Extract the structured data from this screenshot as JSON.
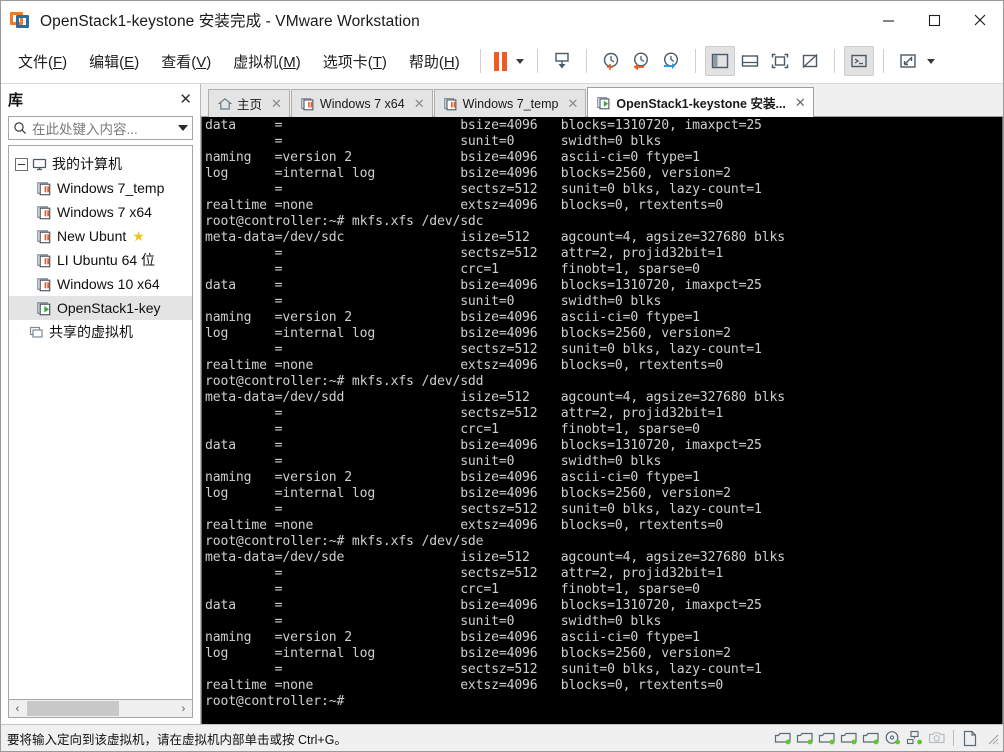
{
  "window": {
    "title": "OpenStack1-keystone 安装完成 - VMware Workstation",
    "logo_icon": "vmware-logo-icon",
    "minimize_label": "最小化",
    "maximize_label": "最大化",
    "close_label": "关闭"
  },
  "menubar": {
    "items": [
      {
        "label": "文件(F)",
        "text": "文件(",
        "accel": "F",
        "tail": ")"
      },
      {
        "label": "编辑(E)",
        "text": "编辑(",
        "accel": "E",
        "tail": ")"
      },
      {
        "label": "查看(V)",
        "text": "查看(",
        "accel": "V",
        "tail": ")"
      },
      {
        "label": "虚拟机(M)",
        "text": "虚拟机(",
        "accel": "M",
        "tail": ")"
      },
      {
        "label": "选项卡(T)",
        "text": "选项卡(",
        "accel": "T",
        "tail": ")"
      },
      {
        "label": "帮助(H)",
        "text": "帮助(",
        "accel": "H",
        "tail": ")"
      }
    ]
  },
  "toolbar": {
    "buttons": [
      {
        "name": "suspend-button",
        "icon": "pause-icon",
        "title": "挂起此虚拟机"
      },
      {
        "name": "power-dropdown",
        "icon": "chevron-down-icon",
        "title": "电源选项"
      },
      {
        "name": "snapshot-button",
        "icon": "snapshot-icon",
        "title": "拍摄此虚拟机的快照"
      },
      {
        "name": "take-snapshot-button",
        "icon": "take-snapshot-icon",
        "title": "拍摄快照"
      },
      {
        "name": "revert-snapshot-button",
        "icon": "revert-snapshot-icon",
        "title": "恢复到快照"
      },
      {
        "name": "snapshot-manager-button",
        "icon": "snapshot-manager-icon",
        "title": "管理快照"
      },
      {
        "name": "show-library-button",
        "icon": "sidebar-panel-icon",
        "title": "显示或隐藏库",
        "active": true
      },
      {
        "name": "show-thumbnail-button",
        "icon": "thumbnail-bar-icon",
        "title": "显示或隐藏缩略图栏"
      },
      {
        "name": "fullscreen-button",
        "icon": "fullscreen-icon",
        "title": "进入全屏模式"
      },
      {
        "name": "unity-button",
        "icon": "unity-mode-icon",
        "title": "进入 Unity 模式"
      },
      {
        "name": "console-button",
        "icon": "terminal-icon",
        "title": "控制台视图",
        "active": true
      },
      {
        "name": "stretch-button",
        "icon": "stretch-icon",
        "title": "拉伸显示"
      },
      {
        "name": "stretch-dropdown",
        "icon": "chevron-down-icon",
        "title": "显示选项"
      }
    ]
  },
  "sidebar": {
    "header_title": "库",
    "close_icon": "close-icon",
    "search": {
      "icon": "search-icon",
      "placeholder": "在此处键入内容...",
      "value": "",
      "dropdown_icon": "chevron-down-icon"
    },
    "tree": {
      "root": {
        "label": "我的计算机",
        "icon": "my-computer-icon",
        "expanded": true
      },
      "items": [
        {
          "label": "Windows 7_temp",
          "icon": "vm-suspended-icon",
          "state": "suspended",
          "favorite": false,
          "selected": false
        },
        {
          "label": "Windows 7 x64",
          "icon": "vm-suspended-icon",
          "state": "suspended",
          "favorite": false,
          "selected": false
        },
        {
          "label": "New Ubunt",
          "icon": "vm-suspended-icon",
          "state": "suspended",
          "favorite": true,
          "selected": false
        },
        {
          "label": "LI Ubuntu 64 位",
          "icon": "vm-suspended-icon",
          "state": "suspended",
          "favorite": false,
          "selected": false
        },
        {
          "label": "Windows 10 x64",
          "icon": "vm-suspended-icon",
          "state": "suspended",
          "favorite": false,
          "selected": false
        },
        {
          "label": "OpenStack1-key",
          "icon": "vm-running-icon",
          "state": "running",
          "favorite": false,
          "selected": true
        }
      ],
      "shared": {
        "label": "共享的虚拟机",
        "icon": "shared-vms-icon"
      }
    },
    "scrollbar": {
      "left_arrow": "‹",
      "right_arrow": "›"
    }
  },
  "tabs": [
    {
      "label": "主页",
      "icon": "home-icon",
      "active": false,
      "close_icon": "close-icon"
    },
    {
      "label": "Windows 7 x64",
      "icon": "vm-suspended-icon",
      "active": false,
      "close_icon": "close-icon"
    },
    {
      "label": "Windows 7_temp",
      "icon": "vm-suspended-icon",
      "active": false,
      "close_icon": "close-icon"
    },
    {
      "label": "OpenStack1-keystone 安装...",
      "icon": "vm-running-icon",
      "active": true,
      "close_icon": "close-icon"
    }
  ],
  "console": {
    "text": "data     =                       bsize=4096   blocks=1310720, imaxpct=25\n         =                       sunit=0      swidth=0 blks\nnaming   =version 2              bsize=4096   ascii-ci=0 ftype=1\nlog      =internal log           bsize=4096   blocks=2560, version=2\n         =                       sectsz=512   sunit=0 blks, lazy-count=1\nrealtime =none                   extsz=4096   blocks=0, rtextents=0\nroot@controller:~# mkfs.xfs /dev/sdc\nmeta-data=/dev/sdc               isize=512    agcount=4, agsize=327680 blks\n         =                       sectsz=512   attr=2, projid32bit=1\n         =                       crc=1        finobt=1, sparse=0\ndata     =                       bsize=4096   blocks=1310720, imaxpct=25\n         =                       sunit=0      swidth=0 blks\nnaming   =version 2              bsize=4096   ascii-ci=0 ftype=1\nlog      =internal log           bsize=4096   blocks=2560, version=2\n         =                       sectsz=512   sunit=0 blks, lazy-count=1\nrealtime =none                   extsz=4096   blocks=0, rtextents=0\nroot@controller:~# mkfs.xfs /dev/sdd\nmeta-data=/dev/sdd               isize=512    agcount=4, agsize=327680 blks\n         =                       sectsz=512   attr=2, projid32bit=1\n         =                       crc=1        finobt=1, sparse=0\ndata     =                       bsize=4096   blocks=1310720, imaxpct=25\n         =                       sunit=0      swidth=0 blks\nnaming   =version 2              bsize=4096   ascii-ci=0 ftype=1\nlog      =internal log           bsize=4096   blocks=2560, version=2\n         =                       sectsz=512   sunit=0 blks, lazy-count=1\nrealtime =none                   extsz=4096   blocks=0, rtextents=0\nroot@controller:~# mkfs.xfs /dev/sde\nmeta-data=/dev/sde               isize=512    agcount=4, agsize=327680 blks\n         =                       sectsz=512   attr=2, projid32bit=1\n         =                       crc=1        finobt=1, sparse=0\ndata     =                       bsize=4096   blocks=1310720, imaxpct=25\n         =                       sunit=0      swidth=0 blks\nnaming   =version 2              bsize=4096   ascii-ci=0 ftype=1\nlog      =internal log           bsize=4096   blocks=2560, version=2\n         =                       sectsz=512   sunit=0 blks, lazy-count=1\nrealtime =none                   extsz=4096   blocks=0, rtextents=0\nroot@controller:~#"
  },
  "statusbar": {
    "message": "要将输入定向到该虚拟机，请在虚拟机内部单击或按 Ctrl+G。",
    "devices": [
      {
        "name": "hard-disk-1-icon",
        "type": "disk",
        "connected": true
      },
      {
        "name": "hard-disk-2-icon",
        "type": "disk",
        "connected": true
      },
      {
        "name": "hard-disk-3-icon",
        "type": "disk",
        "connected": true
      },
      {
        "name": "hard-disk-4-icon",
        "type": "disk",
        "connected": true
      },
      {
        "name": "hard-disk-5-icon",
        "type": "disk",
        "connected": true
      },
      {
        "name": "cd-dvd-icon",
        "type": "cd",
        "connected": true
      },
      {
        "name": "network-adapter-icon",
        "type": "network",
        "connected": true
      },
      {
        "name": "camera-icon",
        "type": "camera",
        "connected": false
      }
    ],
    "extra_icon": "document-icon",
    "resize_grip_icon": "resize-grip-icon"
  },
  "colors": {
    "accent_orange": "#f15a22",
    "accent_blue": "#2b6ca3",
    "running_green": "#3aa83a",
    "favorite_gold": "#f0c419",
    "terminal_bg": "#000000",
    "terminal_fg": "#cfcfcf",
    "chrome_bg": "#f0f0f0"
  }
}
